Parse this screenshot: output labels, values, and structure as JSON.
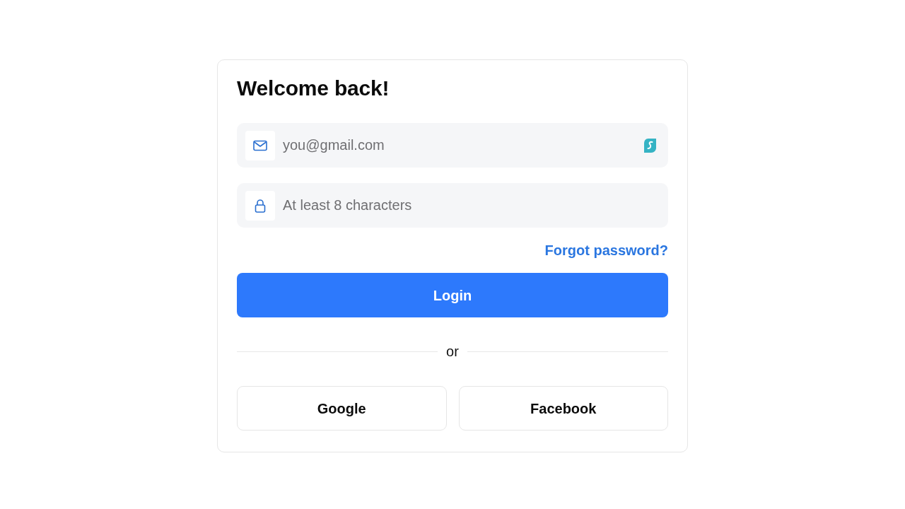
{
  "title": "Welcome back!",
  "fields": [
    {
      "kind": "email",
      "placeholder": "you@gmail.com",
      "extension_icon": true
    },
    {
      "kind": "password",
      "placeholder": "At least 8 characters",
      "extension_icon": false
    }
  ],
  "forgot_link": "Forgot password?",
  "login_button": "Login",
  "divider": "or",
  "social_buttons": [
    "Google",
    "Facebook"
  ]
}
